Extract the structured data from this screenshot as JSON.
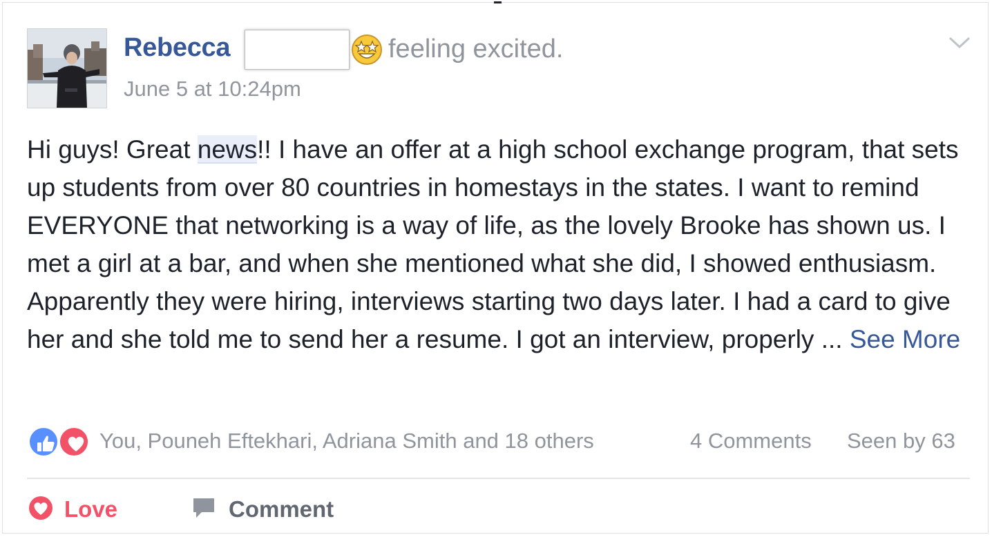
{
  "post": {
    "author": "Rebecca",
    "feeling": "feeling excited.",
    "timestamp": "June 5 at 10:24pm",
    "text_before_highlight": "Hi guys! Great ",
    "highlighted_word": "news",
    "text_after_highlight": "!! I have an offer at a high school exchange program, that sets up students from over 80 countries in homestays in the states. I want to remind EVERYONE that networking is a way of life, as the lovely Brooke has shown us. I met a girl at a bar, and when she mentioned what she did, I showed enthusiasm. Apparently they were hiring, interviews starting two days later. I had a card to give her and she told me to send her a resume. I got an interview, properly ... ",
    "see_more": "See More"
  },
  "icons": {
    "avatar": "profile-photo",
    "emoji": "star-struck-emoji",
    "menu": "chevron-down-icon",
    "like_reaction": "thumbs-up-icon",
    "love_reaction": "heart-icon",
    "love_action": "heart-outline-icon",
    "comment_action": "speech-bubble-icon"
  },
  "reactions": {
    "summary": "You, Pouneh Eftekhari, Adriana Smith and 18 others",
    "comments": "4 Comments",
    "seen_by": "Seen by 63"
  },
  "actions": {
    "love": "Love",
    "comment": "Comment"
  },
  "colors": {
    "link_blue": "#365899",
    "love_red": "#f25268",
    "like_blue": "#5890ff",
    "muted_gray": "#90949c",
    "text_dark": "#1d2129"
  }
}
